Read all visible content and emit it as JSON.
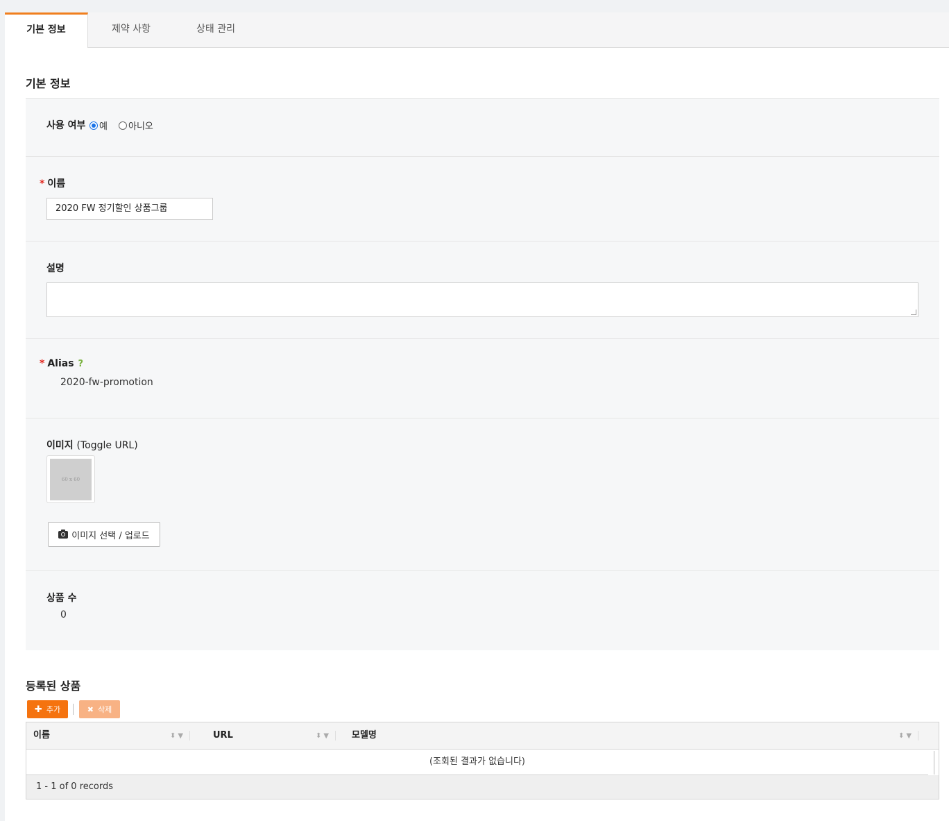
{
  "tabs": [
    "기본 정보",
    "제약 사항",
    "상태 관리"
  ],
  "basic_section_title": "기본 정보",
  "usage": {
    "label": "사용 여부",
    "options": [
      "예",
      "아니오"
    ],
    "selected": "예"
  },
  "name": {
    "label": "이름",
    "value": "2020 FW 정기할인 상품그룹"
  },
  "description": {
    "label": "설명",
    "value": ""
  },
  "alias": {
    "label": "Alias",
    "help": "?",
    "value": "2020-fw-promotion"
  },
  "image": {
    "label": "이미지",
    "toggle": "(Toggle URL)",
    "placeholder_text": "60 x 60",
    "upload_button": "이미지 선택 / 업로드"
  },
  "product_count": {
    "label": "상품 수",
    "value": "0"
  },
  "registered": {
    "title": "등록된 상품",
    "add_button": "추가",
    "delete_button": "삭제",
    "columns": [
      "이름",
      "URL",
      "모델명"
    ],
    "empty_message": "(조회된 결과가 없습니다)",
    "footer": "1 - 1 of 0 records"
  },
  "colors": {
    "accent": "#f5730f",
    "accent_light": "#f8b284",
    "required": "#e2231a",
    "help": "#7cb342",
    "radio": "#1a73e8"
  }
}
